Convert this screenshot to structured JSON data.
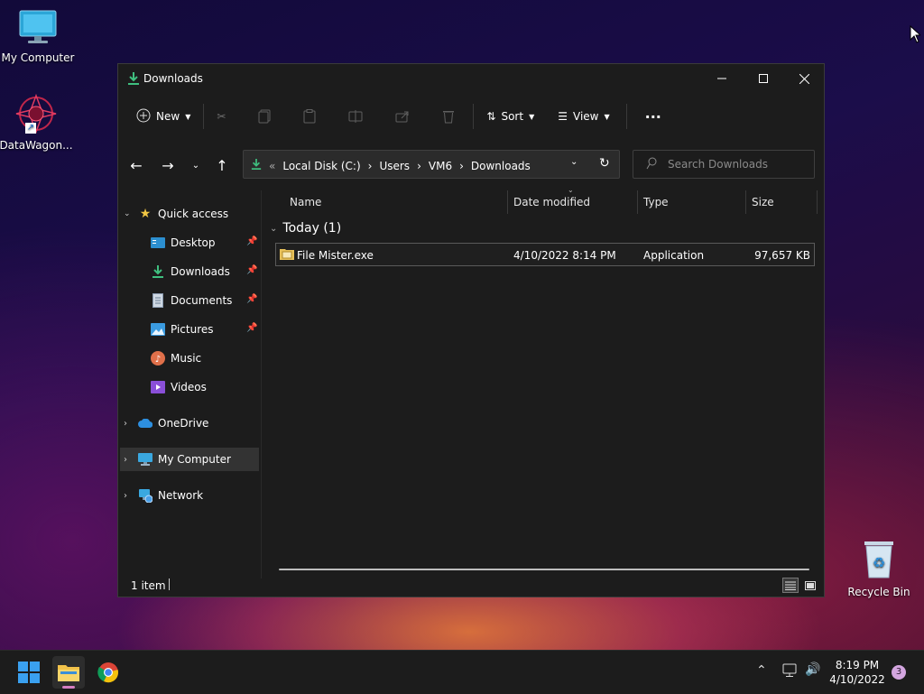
{
  "desktop": {
    "icons": [
      {
        "label": "My Computer",
        "icon": "monitor-icon"
      },
      {
        "label": "DataWagon...",
        "icon": "app-shortcut-icon"
      },
      {
        "label": "Recycle Bin",
        "icon": "recycle-bin-icon"
      }
    ]
  },
  "window": {
    "title": "Downloads",
    "title_icon": "download-icon",
    "controls": {
      "minimize": "minimize-icon",
      "maximize": "maximize-icon",
      "close": "close-icon"
    }
  },
  "toolbar": {
    "new_label": "New",
    "sort_label": "Sort",
    "view_label": "View",
    "more_label": "···",
    "disabled_actions": [
      "cut",
      "copy",
      "paste",
      "rename",
      "share",
      "delete"
    ]
  },
  "address": {
    "prefix": "«",
    "crumbs": [
      "Local Disk (C:)",
      "Users",
      "VM6",
      "Downloads"
    ]
  },
  "search": {
    "placeholder": "Search Downloads"
  },
  "sidebar": {
    "quick_access": "Quick access",
    "items": [
      {
        "label": "Desktop",
        "icon": "desktop-icon",
        "pinned": true
      },
      {
        "label": "Downloads",
        "icon": "download-icon",
        "pinned": true
      },
      {
        "label": "Documents",
        "icon": "documents-icon",
        "pinned": true
      },
      {
        "label": "Pictures",
        "icon": "pictures-icon",
        "pinned": true
      },
      {
        "label": "Music",
        "icon": "music-icon",
        "pinned": false
      },
      {
        "label": "Videos",
        "icon": "videos-icon",
        "pinned": false
      }
    ],
    "onedrive": "OneDrive",
    "my_computer": "My Computer",
    "network": "Network"
  },
  "columns": {
    "name": "Name",
    "date": "Date modified",
    "type": "Type",
    "size": "Size"
  },
  "group": {
    "label": "Today (1)"
  },
  "files": [
    {
      "name": "File Mister.exe",
      "date": "4/10/2022 8:14 PM",
      "type": "Application",
      "size": "97,657 KB"
    }
  ],
  "status": {
    "count": "1 item"
  },
  "taskbar": {
    "time": "8:19 PM",
    "date": "4/10/2022",
    "notification_count": "3",
    "apps": [
      "start-icon",
      "file-explorer-icon",
      "chrome-icon"
    ]
  },
  "colors": {
    "accent": "#3fbf7f",
    "window_bg": "#1c1c1c",
    "taskbar_bg": "#1c1c1c",
    "selection": "#333333"
  }
}
